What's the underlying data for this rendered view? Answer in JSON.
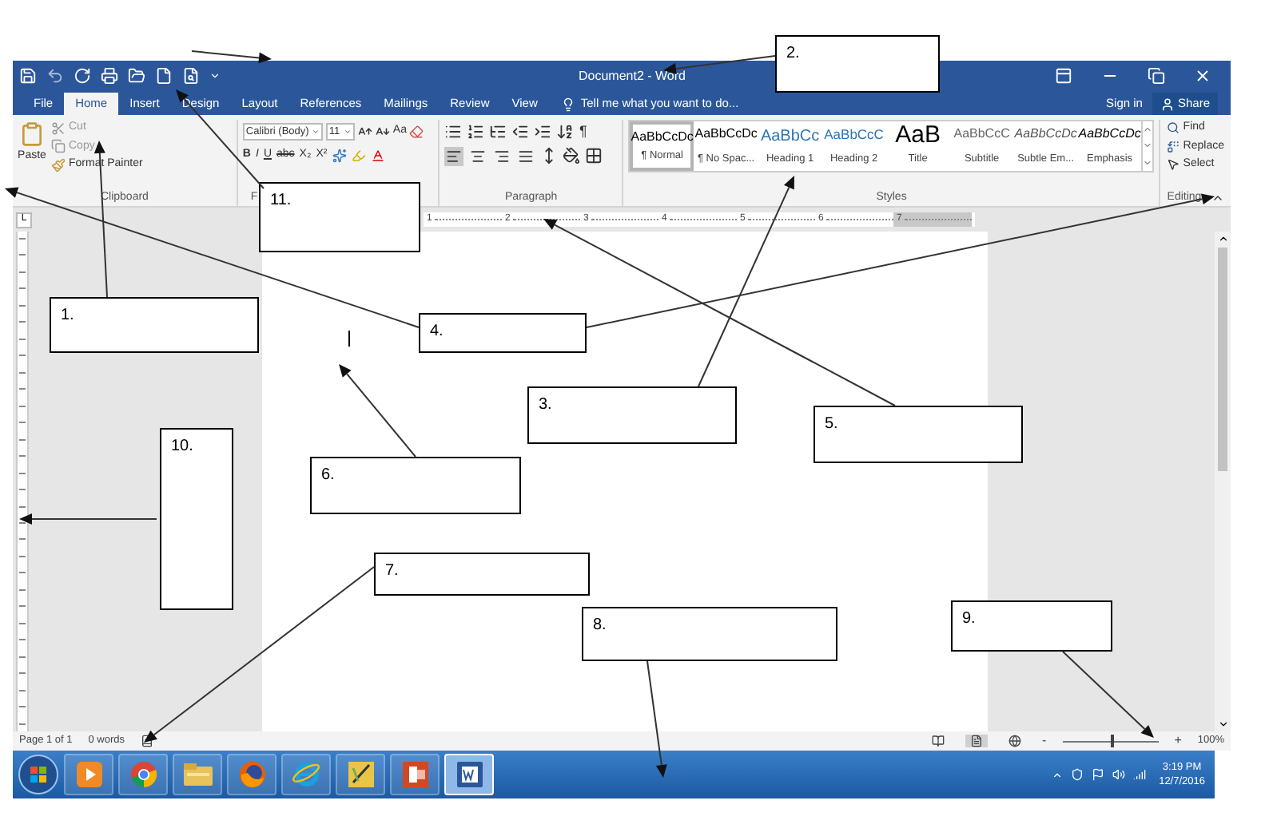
{
  "window": {
    "title": "Document2 - Word"
  },
  "tabs": [
    {
      "label": "File",
      "selected": false
    },
    {
      "label": "Home",
      "selected": true
    },
    {
      "label": "Insert",
      "selected": false
    },
    {
      "label": "Design",
      "selected": false
    },
    {
      "label": "Layout",
      "selected": false
    },
    {
      "label": "References",
      "selected": false
    },
    {
      "label": "Mailings",
      "selected": false
    },
    {
      "label": "Review",
      "selected": false
    },
    {
      "label": "View",
      "selected": false
    }
  ],
  "tell_me": {
    "placeholder": "Tell me what you want to do..."
  },
  "account": {
    "sign_in": "Sign in",
    "share": "Share"
  },
  "ribbon": {
    "clipboard": {
      "label": "Clipboard",
      "paste": "Paste",
      "cut": "Cut",
      "copy": "Copy",
      "format_painter": "Format Painter"
    },
    "font": {
      "label": "F",
      "font_name": "Calibri (Body)",
      "font_size": "11",
      "change_case": "Aa",
      "buttons": [
        "B",
        "I",
        "U",
        "abc",
        "X₂",
        "X²"
      ]
    },
    "paragraph": {
      "label": "Paragraph",
      "pilcrow": "¶",
      "alignment": [
        {
          "selected": true
        },
        {
          "selected": false
        },
        {
          "selected": false
        },
        {
          "selected": false
        }
      ]
    },
    "styles": {
      "label": "Styles",
      "items": [
        {
          "preview": "AaBbCcDc",
          "name": "¶ Normal",
          "kind": "normal",
          "selected": true
        },
        {
          "preview": "AaBbCcDc",
          "name": "¶ No Spac...",
          "kind": "normal",
          "selected": false
        },
        {
          "preview": "AaBbCc",
          "name": "Heading 1",
          "kind": "heading1",
          "selected": false
        },
        {
          "preview": "AaBbCcC",
          "name": "Heading 2",
          "kind": "heading2",
          "selected": false
        },
        {
          "preview": "AaB",
          "name": "Title",
          "kind": "title",
          "selected": false
        },
        {
          "preview": "AaBbCcC",
          "name": "Subtitle",
          "kind": "subtitle",
          "selected": false
        },
        {
          "preview": "AaBbCcDc",
          "name": "Subtle Em...",
          "kind": "subtle",
          "selected": false
        },
        {
          "preview": "AaBbCcDc",
          "name": "Emphasis",
          "kind": "emphasis",
          "selected": false
        }
      ]
    },
    "editing": {
      "label": "Editing",
      "find": "Find",
      "replace": "Replace",
      "select": "Select"
    }
  },
  "ruler": {
    "tab_selector": "L",
    "marks": [
      "1",
      "2",
      "3",
      "4",
      "5",
      "6",
      "7"
    ]
  },
  "status_bar": {
    "page": "Page 1 of 1",
    "words": "0 words",
    "views": [
      {
        "selected": false
      },
      {
        "selected": true
      },
      {
        "selected": false
      }
    ],
    "zoom_out": "-",
    "zoom": {
      "level": 0.5
    },
    "zoom_in": "+",
    "zoom_percent": "100%"
  },
  "taskbar": {
    "apps": [
      {
        "kind": "media",
        "selected": false
      },
      {
        "kind": "chrome",
        "selected": false
      },
      {
        "kind": "explorer",
        "selected": false
      },
      {
        "kind": "firefox",
        "selected": false
      },
      {
        "kind": "ie",
        "selected": false
      },
      {
        "kind": "notes",
        "selected": false
      },
      {
        "kind": "powerpoint",
        "selected": false
      },
      {
        "kind": "word",
        "selected": true
      }
    ],
    "time": "3:19 PM",
    "date": "12/7/2016"
  },
  "annotations": [
    {
      "label": "2."
    },
    {
      "label": "11."
    },
    {
      "label": "1."
    },
    {
      "label": "4."
    },
    {
      "label": "3."
    },
    {
      "label": "5."
    },
    {
      "label": "10."
    },
    {
      "label": "6."
    },
    {
      "label": "7."
    },
    {
      "label": "9."
    },
    {
      "label": "8."
    }
  ]
}
